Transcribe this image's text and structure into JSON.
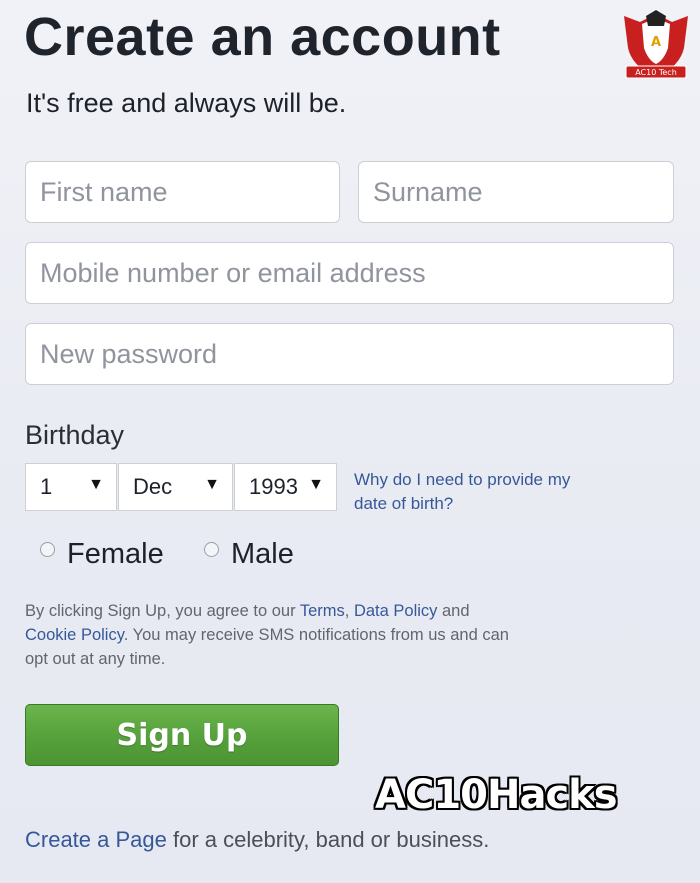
{
  "header": {
    "title": "Create an account",
    "subtitle": "It's free and always will be."
  },
  "form": {
    "first_name_placeholder": "First name",
    "surname_placeholder": "Surname",
    "contact_placeholder": "Mobile number or email address",
    "password_placeholder": "New password",
    "birthday_label": "Birthday",
    "birthday": {
      "day": "1",
      "month": "Dec",
      "year": "1993"
    },
    "why_link": "Why do I need to provide my date of birth?",
    "gender_options": [
      "Female",
      "Male"
    ]
  },
  "terms": {
    "prefix": "By clicking Sign Up, you agree to our ",
    "terms_link": "Terms",
    "comma": ", ",
    "data_policy_link": "Data Policy",
    "and": " and ",
    "cookie_link": "Cookie Policy",
    "suffix": ". You may receive SMS notifications from us and can opt out at any time."
  },
  "signup_label": "Sign Up",
  "watermark": "AC10Hacks",
  "footer": {
    "create_page_link": "Create a Page",
    "create_page_rest": " for a celebrity, band or business."
  },
  "logo": {
    "letter": "A",
    "text": "AC10 Tech"
  },
  "colors": {
    "link": "#365899",
    "button_green": "#56a13b",
    "logo_red": "#c8201f"
  }
}
